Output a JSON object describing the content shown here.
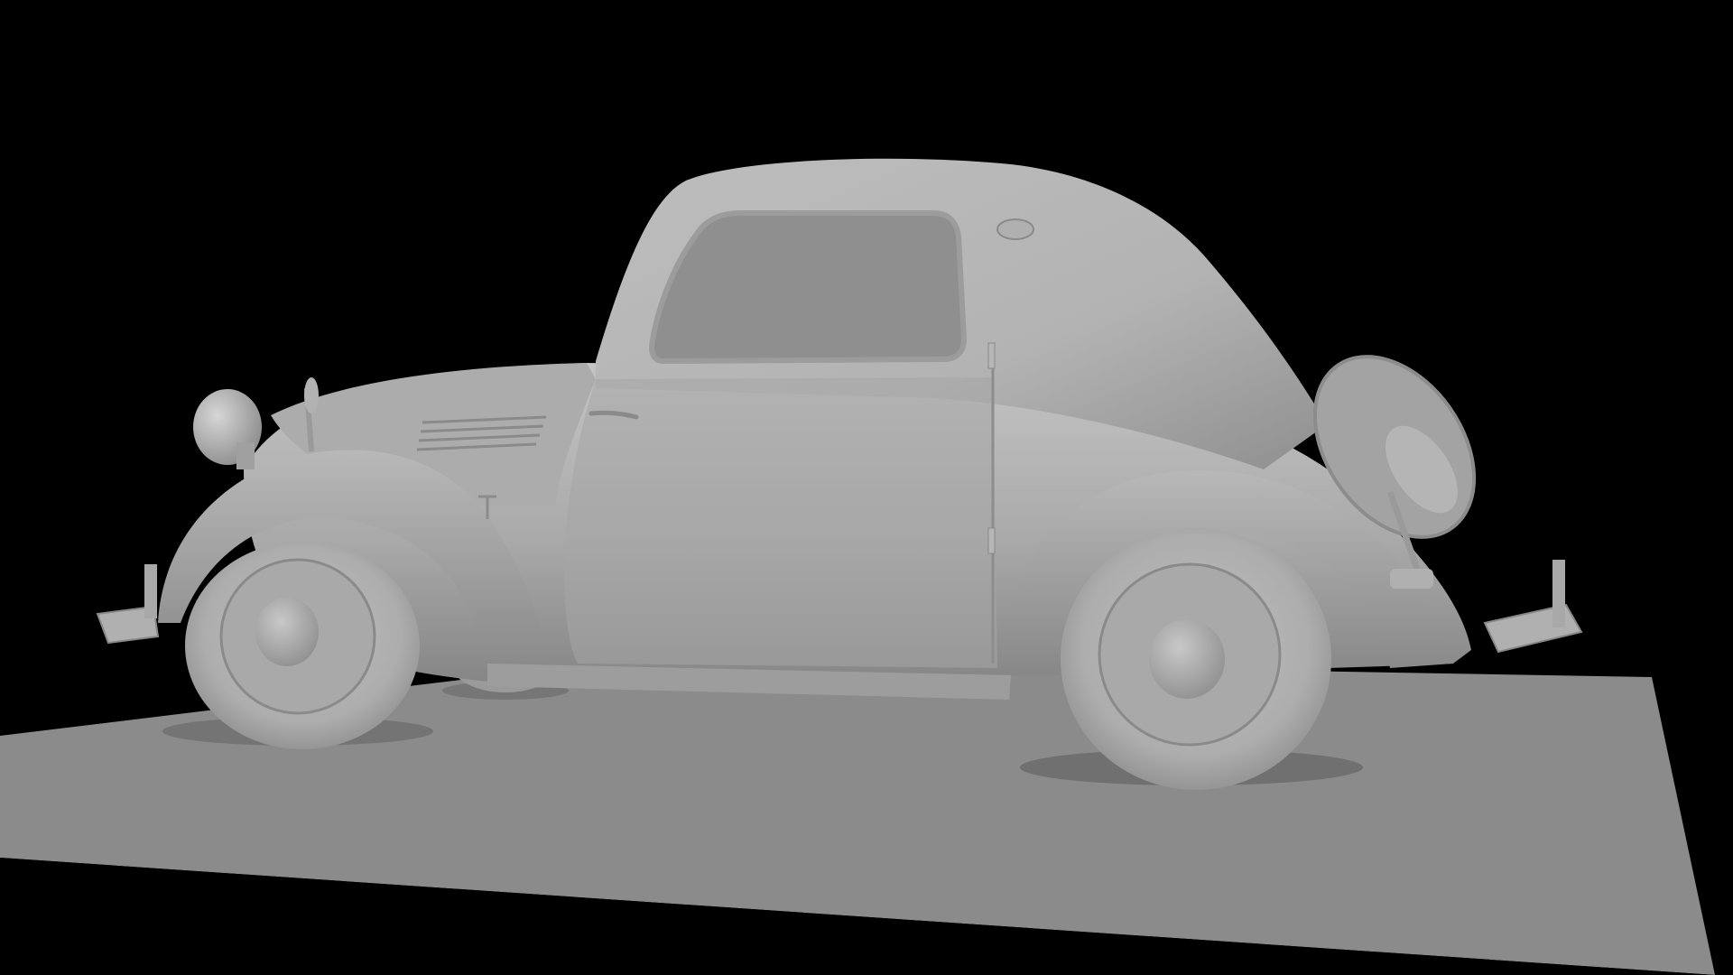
{
  "scene": {
    "subject": "car-model",
    "render_style": "clay-grey",
    "colors": {
      "background": "#000000",
      "ground": "#8a8a8a",
      "body": "#a8a8a8",
      "body_highlight": "#c2c2c2",
      "body_shadow": "#6e6e6e",
      "window": "#8e8e8e",
      "tire": "#b4b4b4",
      "hub": "#a0a0a0"
    }
  }
}
